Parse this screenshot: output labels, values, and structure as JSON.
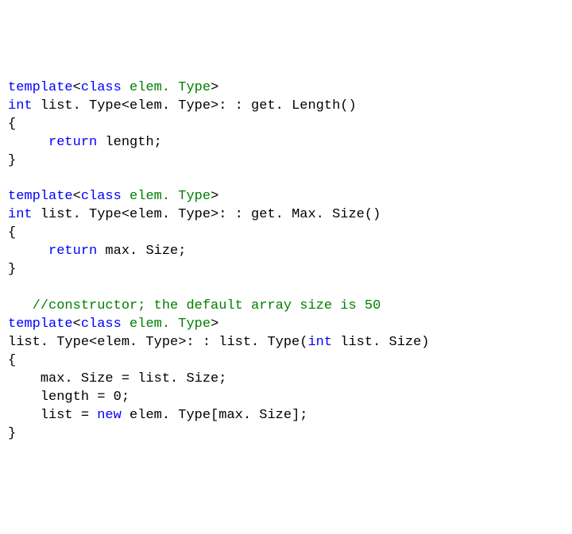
{
  "kw": {
    "template": "template",
    "class": "class",
    "int": "int",
    "return": "return",
    "new": "new"
  },
  "type": {
    "elemType": "elem. Type"
  },
  "fn1": {
    "sig_prefix": " list. Type<elem. Type>: : get. Length()",
    "open": "{",
    "ret_expr": " length;",
    "close": "}"
  },
  "fn2": {
    "sig_prefix": " list. Type<elem. Type>: : get. Max. Size()",
    "open": "{",
    "ret_expr": " max. Size;",
    "close": "}"
  },
  "comment": "//constructor; the default array size is 50",
  "fn3": {
    "sig_before_int": "list. Type<elem. Type>: : list. Type(",
    "sig_after_int": " list. Size)",
    "open": "{",
    "l1": "max. Size = list. Size;",
    "l2": "length = 0;",
    "l3_a": "list = ",
    "l3_b": " elem. Type[max. Size];",
    "close": "}"
  },
  "sym": {
    "lt": "<",
    "gt": ">",
    "sp": " "
  }
}
